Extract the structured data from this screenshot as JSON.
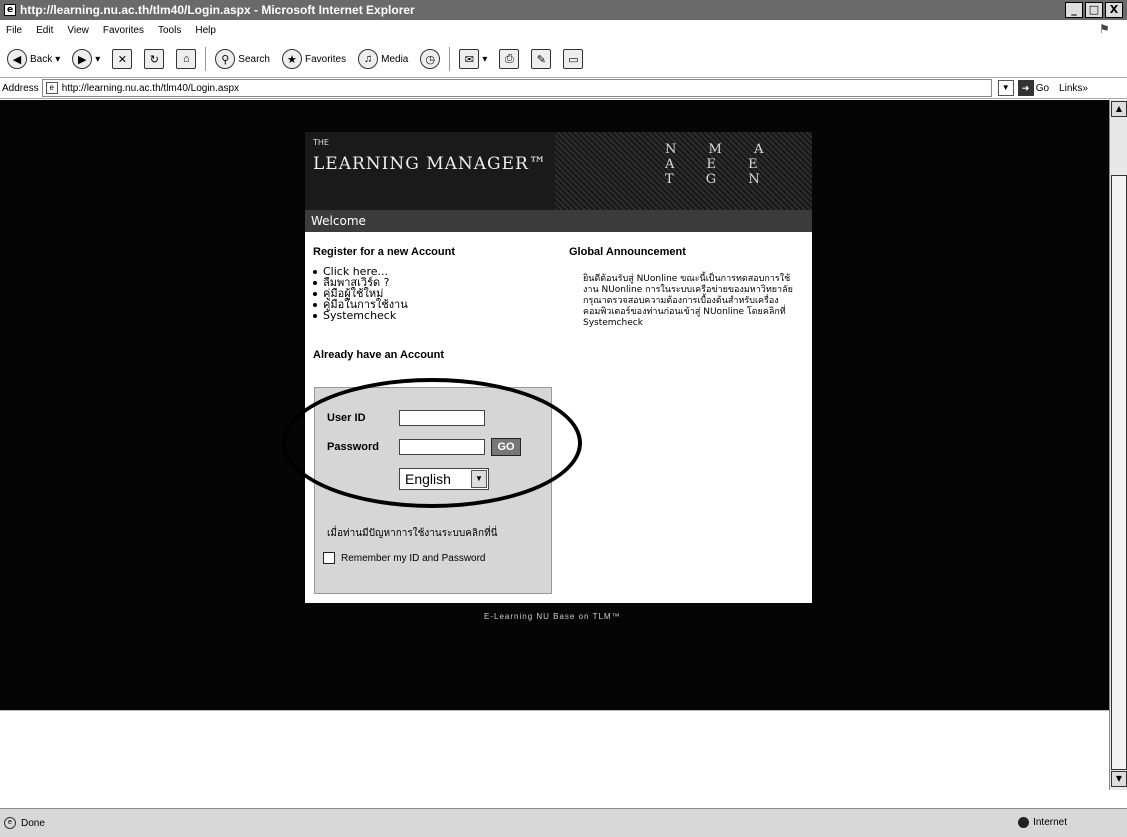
{
  "window": {
    "title": "http://learning.nu.ac.th/tlm40/Login.aspx - Microsoft Internet Explorer",
    "buttons": [
      "_",
      "□",
      "X"
    ]
  },
  "menu": [
    "File",
    "Edit",
    "View",
    "Favorites",
    "Tools",
    "Help"
  ],
  "toolbar": {
    "back": "Back",
    "search": "Search",
    "favorites": "Favorites",
    "media": "Media"
  },
  "address": {
    "label": "Address",
    "url": "http://learning.nu.ac.th/tlm40/Login.aspx",
    "go": "Go",
    "links": "Links"
  },
  "banner": {
    "small": "THE",
    "logo": "LEARNING MANAGER",
    "tm": "™",
    "letters": "N M A A E E T G N"
  },
  "welcome": "Welcome",
  "register": {
    "heading": "Register for a new Account",
    "items": [
      "Click here...",
      "ลืมพาสเวิร์ด ?",
      "คู่มือผู้ใช้ใหม่",
      "คู่มือในการใช้งาน",
      "Systemcheck"
    ]
  },
  "announcement": {
    "heading": "Global Announcement",
    "text": "ยินดีต้อนรับสู่ NUonline ขณะนี้เป็นการทดสอบการใช้งาน NUonline การในระบบเครือข่ายของมหาวิทยาลัย กรุณาตรวจสอบความต้องการเบื้องต้นสำหรับเครื่องคอมพิวเตอร์ของท่านก่อนเข้าสู่ NUonline โดยคลิกที่ Systemcheck"
  },
  "login": {
    "already": "Already have an Account",
    "user_label": "User ID",
    "password_label": "Password",
    "go_label": "GO",
    "language": "English",
    "problem": "เมื่อท่านมีปัญหาการใช้งานระบบคลิกที่นี่",
    "remember": "Remember my ID and Password"
  },
  "footer": "E-Learning NU Base on TLM™",
  "status": {
    "left": "Done",
    "zone": "Internet"
  }
}
